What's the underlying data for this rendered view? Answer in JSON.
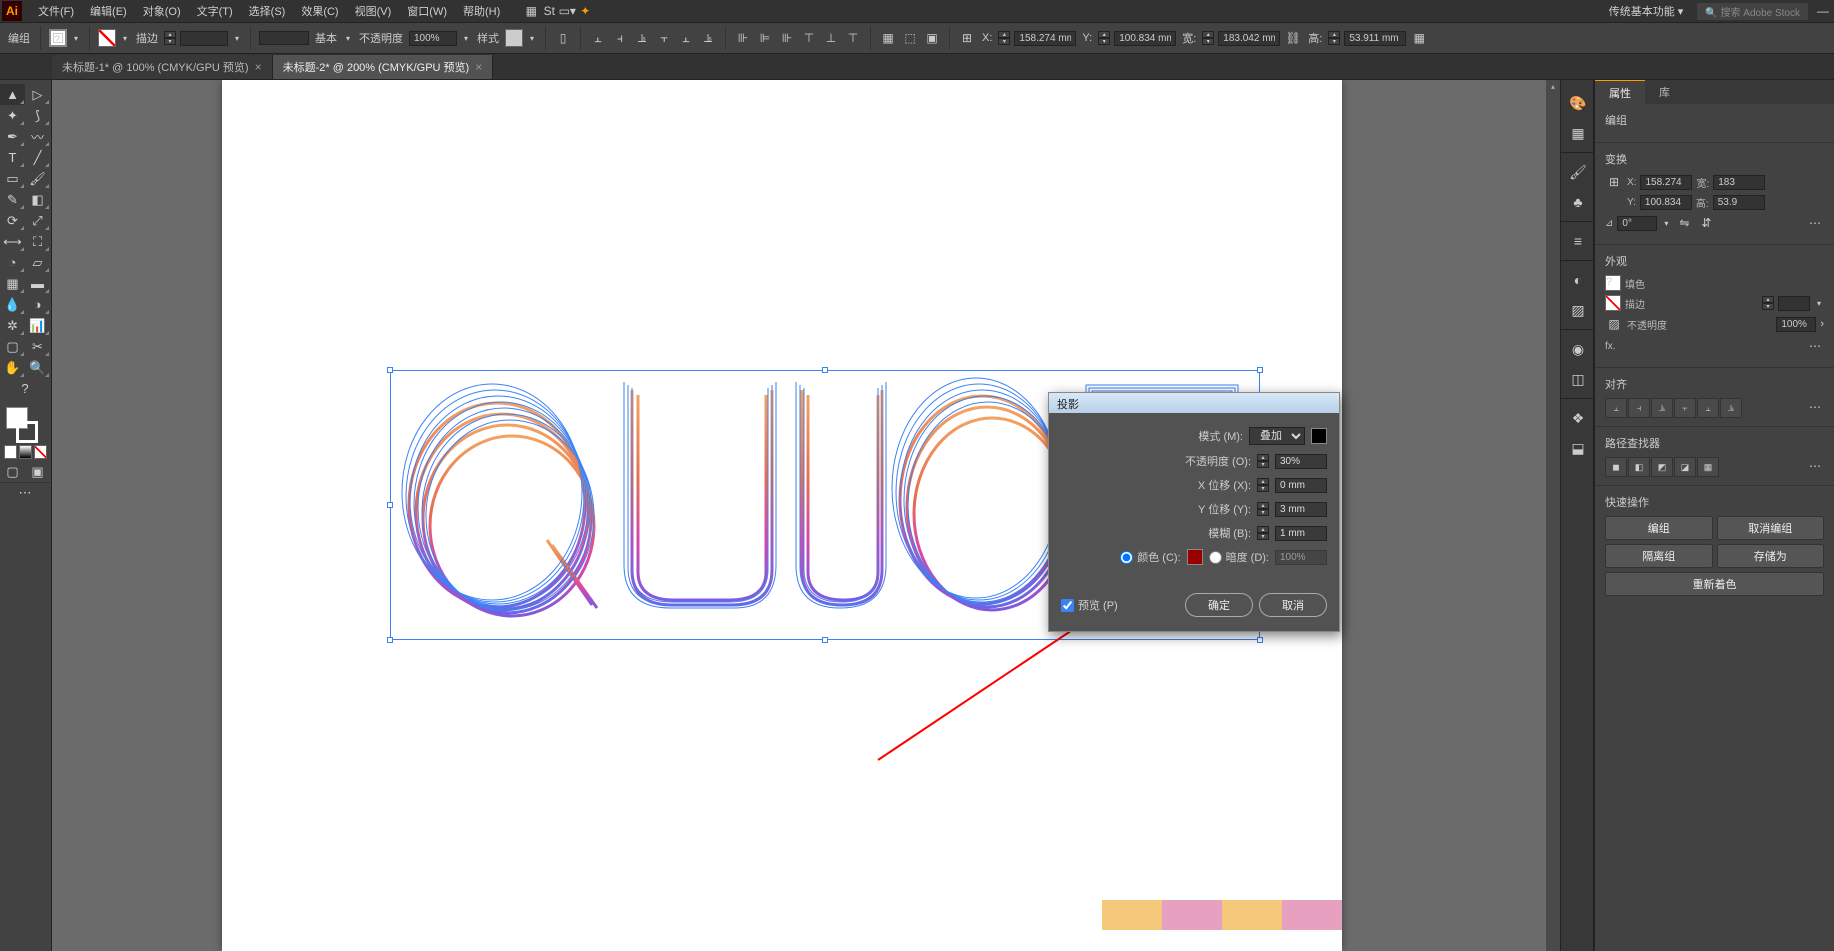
{
  "menu": {
    "items": [
      "文件(F)",
      "编辑(E)",
      "对象(O)",
      "文字(T)",
      "选择(S)",
      "效果(C)",
      "视图(V)",
      "窗口(W)",
      "帮助(H)"
    ],
    "workspace": "传统基本功能",
    "search_placeholder": "搜索 Adobe Stock"
  },
  "controlbar": {
    "mode": "编组",
    "stroke_label": "描边",
    "stroke_weight": "",
    "profile": "基本",
    "opacity_label": "不透明度",
    "opacity": "100%",
    "style_label": "样式",
    "x_label": "X:",
    "x_val": "158.274 mm",
    "y_label": "Y:",
    "y_val": "100.834 mm",
    "w_label": "宽:",
    "w_val": "183.042 mm",
    "h_label": "高:",
    "h_val": "53.911 mm"
  },
  "tabs": [
    {
      "label": "未标题-1* @ 100% (CMYK/GPU 预览)"
    },
    {
      "label": "未标题-2* @ 200% (CMYK/GPU 预览)"
    }
  ],
  "dialog": {
    "title": "投影",
    "mode_label": "模式 (M):",
    "mode_value": "叠加",
    "opacity_label": "不透明度 (O):",
    "opacity_value": "30%",
    "x_label": "X 位移 (X):",
    "x_value": "0 mm",
    "y_label": "Y 位移 (Y):",
    "y_value": "3 mm",
    "blur_label": "模糊 (B):",
    "blur_value": "1 mm",
    "color_label": "颜色 (C):",
    "dark_label": "暗度 (D):",
    "dark_value": "100%",
    "preview_label": "预览 (P)",
    "ok": "确定",
    "cancel": "取消"
  },
  "properties": {
    "tab_props": "属性",
    "tab_lib": "库",
    "obj_type": "编组",
    "transform_title": "变换",
    "x": "158.274",
    "y": "100.834",
    "w": "183",
    "h": "53.9",
    "w_label": "宽:",
    "h_label": "高:",
    "rotate": "0°",
    "appearance_title": "外观",
    "fill_label": "填色",
    "stroke_label": "描边",
    "opacity_label": "不透明度",
    "opacity_val": "100%",
    "fx_label": "fx.",
    "align_title": "对齐",
    "pathfinder_title": "路径查找器",
    "quick_title": "快速操作",
    "btn_group": "编组",
    "btn_ungroup": "取消编组",
    "btn_isolate": "隔离组",
    "btn_save": "存储为",
    "btn_recolor": "重新着色"
  },
  "x_prefix": "X:",
  "y_prefix": "Y:"
}
